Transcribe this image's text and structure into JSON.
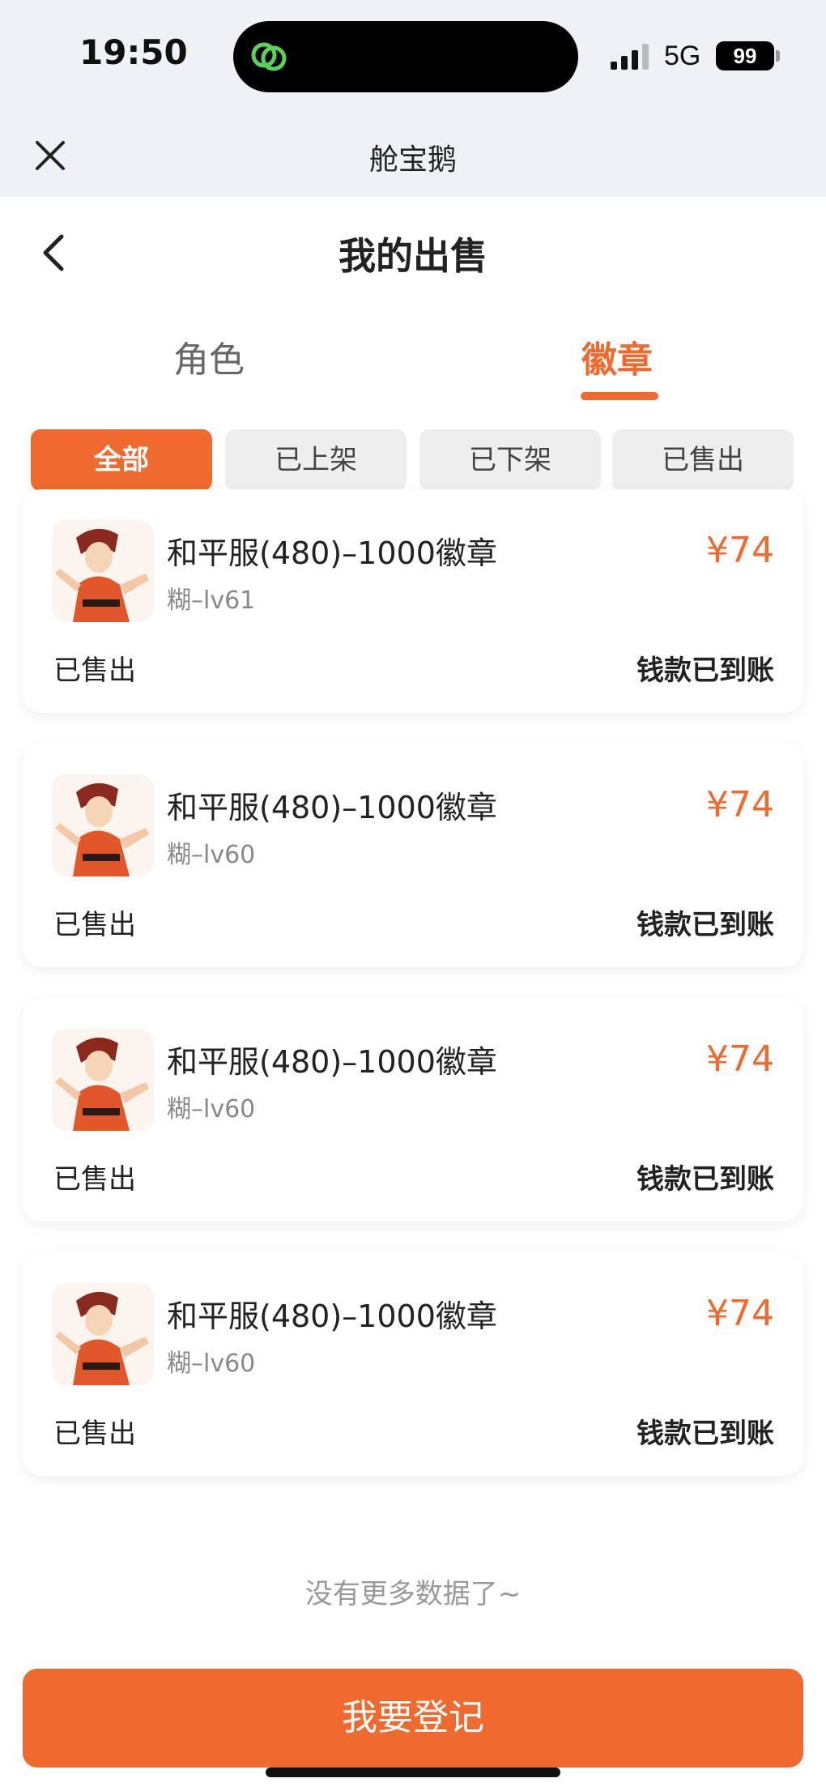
{
  "status_bar": {
    "time": "19:50",
    "network": "5G",
    "battery": "99"
  },
  "miniprogram": {
    "title": "舱宝鹅"
  },
  "page": {
    "title": "我的出售"
  },
  "category_tabs": [
    {
      "label": "角色",
      "active": false
    },
    {
      "label": "徽章",
      "active": true
    }
  ],
  "filters": [
    {
      "label": "全部",
      "active": true
    },
    {
      "label": "已上架",
      "active": false
    },
    {
      "label": "已下架",
      "active": false
    },
    {
      "label": "已售出",
      "active": false
    }
  ],
  "items": [
    {
      "title": "和平服(480)–1000徽章",
      "subtitle": "糊–lv61",
      "price": "¥74",
      "status": "已售出",
      "payment": "钱款已到账"
    },
    {
      "title": "和平服(480)–1000徽章",
      "subtitle": "糊–lv60",
      "price": "¥74",
      "status": "已售出",
      "payment": "钱款已到账"
    },
    {
      "title": "和平服(480)–1000徽章",
      "subtitle": "糊–lv60",
      "price": "¥74",
      "status": "已售出",
      "payment": "钱款已到账"
    },
    {
      "title": "和平服(480)–1000徽章",
      "subtitle": "糊–lv60",
      "price": "¥74",
      "status": "已售出",
      "payment": "钱款已到账"
    }
  ],
  "footer": {
    "no_more": "没有更多数据了~",
    "cta_label": "我要登记"
  },
  "colors": {
    "accent": "#ee6a2e",
    "topbar_bg": "#eef1f5"
  }
}
